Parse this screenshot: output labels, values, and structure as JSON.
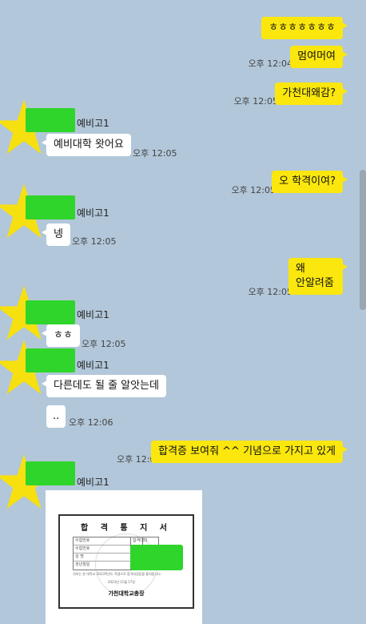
{
  "chat": {
    "sender_name": "예비고1",
    "messages": [
      {
        "from": "me",
        "text": "ㅎㅎㅎㅎㅎㅎㅎ",
        "time": ""
      },
      {
        "from": "me",
        "text": "멈여머여",
        "time": "오후 12:04"
      },
      {
        "from": "me",
        "text": "가천대왜감?",
        "time": "오후 12:05"
      },
      {
        "from": "other",
        "text": "예비대학 왓어요",
        "time": "오후 12:05"
      },
      {
        "from": "me",
        "text": "오 학격이여?",
        "time": "오후 12:05"
      },
      {
        "from": "other",
        "text": "넹",
        "time": "오후 12:05"
      },
      {
        "from": "me",
        "text_lines": [
          "왜",
          "안알려줌"
        ],
        "time": "오후 12:05"
      },
      {
        "from": "other",
        "text": "ㅎㅎ",
        "time": "오후 12:05"
      },
      {
        "from": "other",
        "text": "다른데도 될 줄 알앗는데",
        "time": ""
      },
      {
        "from": "other",
        "text": "..",
        "time": "오후 12:06"
      },
      {
        "from": "me",
        "text": "합격증 보여줘 ^^ 기념으로 가지고 있게",
        "time": "오후 12:06"
      }
    ],
    "attachment": {
      "title": "합 격 통 지 서",
      "rows": [
        "수험번호",
        "수험번호",
        "성 명",
        "생년월일"
      ],
      "cell_label": "합격대학",
      "note": "귀하는 본 대학교 2023학년도 학생으로 합격되었음을 통지합니다.",
      "date": "2023년 11월 17일",
      "issuer": "가천대학교총장"
    }
  },
  "icons": {
    "avatar": "star-avatar-icon",
    "name_redaction": "green-redaction"
  },
  "colors": {
    "background": "#b2c7d9",
    "my_bubble": "#fbe70d",
    "other_bubble": "#ffffff",
    "redaction": "#2fd52a",
    "avatar_star": "#f7e010"
  }
}
